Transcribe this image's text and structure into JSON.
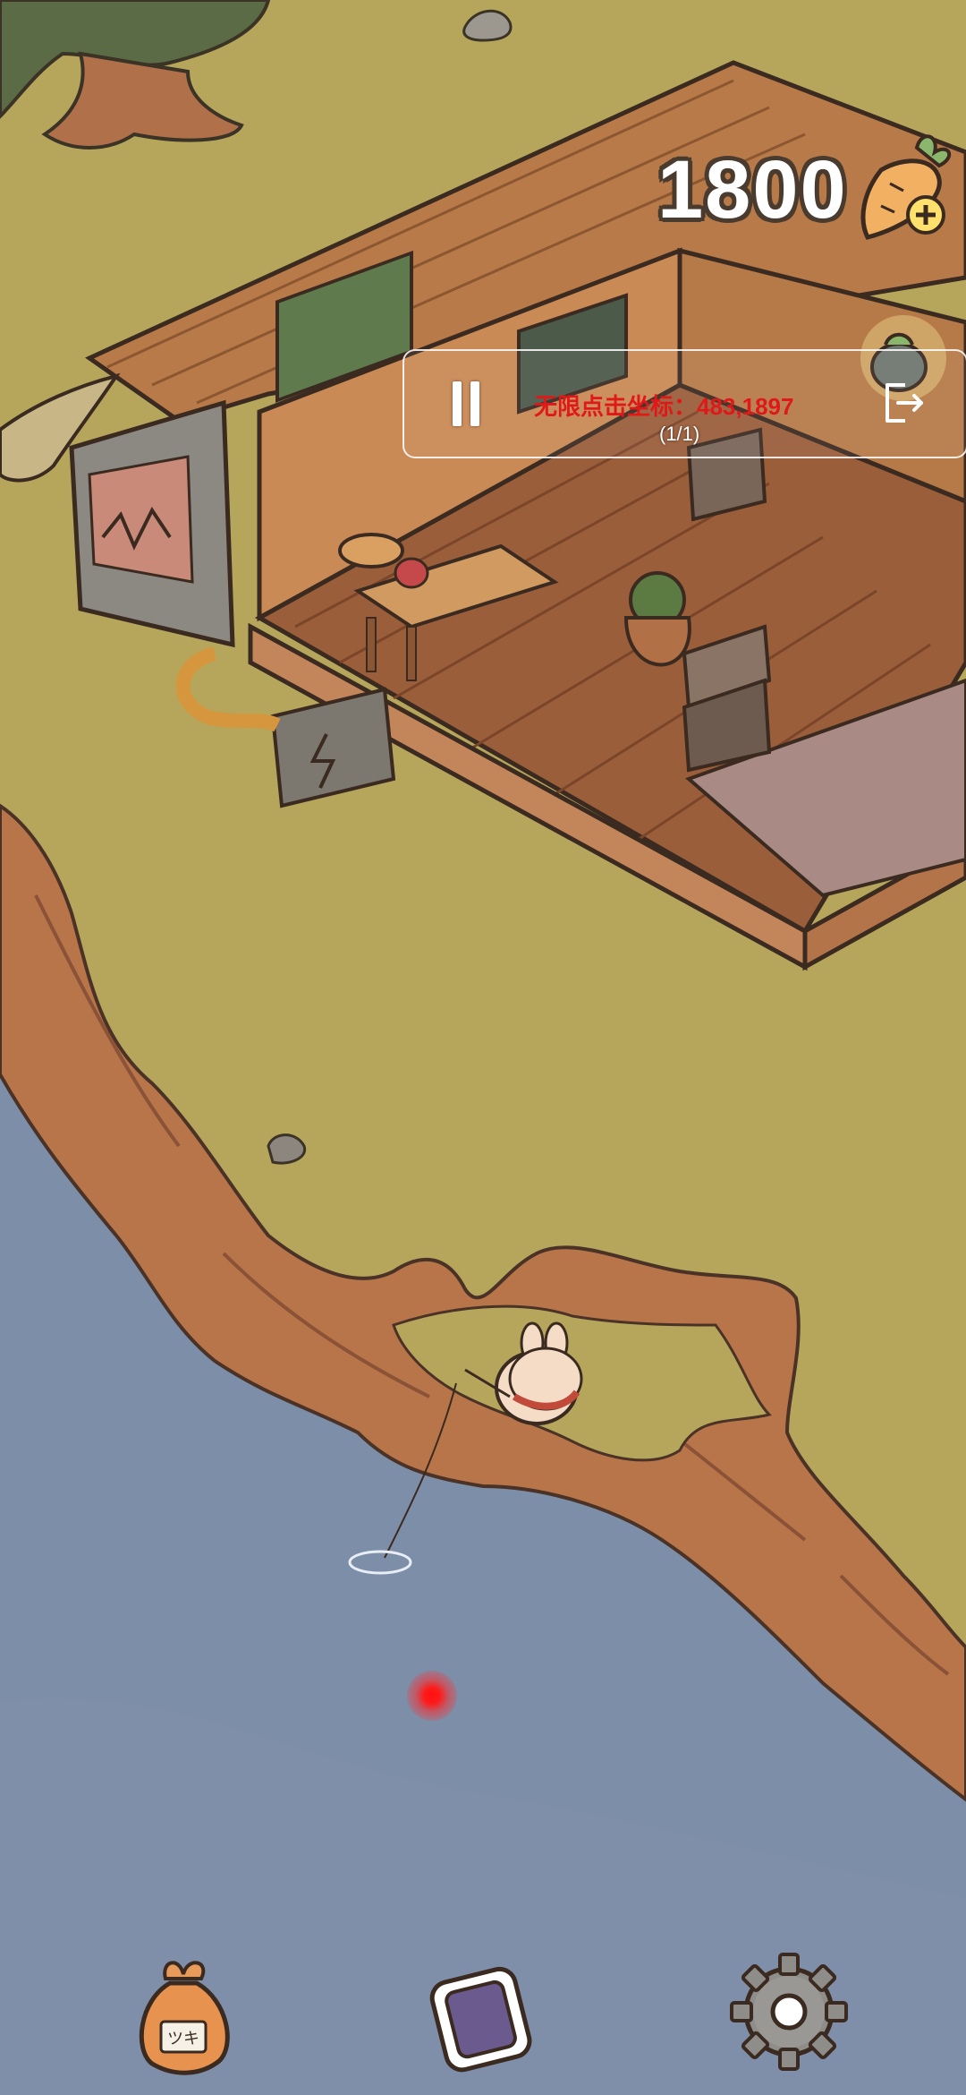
{
  "hud": {
    "carrot_count": "1800"
  },
  "auto_clicker": {
    "status_text": "无限点击坐标：483,1897",
    "progress": "(1/1)"
  },
  "bag": {
    "tag_text": "ツキ"
  },
  "colors": {
    "grass": "#b6a65c",
    "water": "#7d8ea9",
    "cliff": "#b9754a",
    "wood": "#a86a3c",
    "accent_red": "#e01818"
  }
}
